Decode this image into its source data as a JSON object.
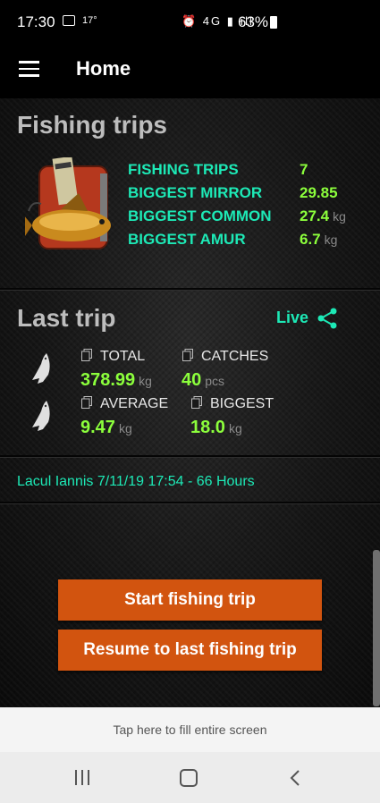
{
  "status_bar": {
    "time": "17:30",
    "temperature": "17°",
    "icons": "⏰ 4G ▮ ıll",
    "battery": "63%"
  },
  "app_bar": {
    "title": "Home",
    "menu_icon": "menu-icon"
  },
  "fishing_trips": {
    "heading": "Fishing trips",
    "stats": [
      {
        "label": "FISHING TRIPS",
        "value": "7",
        "unit": ""
      },
      {
        "label": "BIGGEST MIRROR",
        "value": "29.85",
        "unit": ""
      },
      {
        "label": "BIGGEST COMMON",
        "value": "27.4",
        "unit": "kg"
      },
      {
        "label": "BIGGEST AMUR",
        "value": "6.7",
        "unit": "kg"
      }
    ]
  },
  "last_trip": {
    "heading": "Last trip",
    "live_label": "Live",
    "total": {
      "label": "TOTAL",
      "value": "378.99",
      "unit": "kg"
    },
    "catches": {
      "label": "CATCHES",
      "value": "40",
      "unit": "pcs"
    },
    "average": {
      "label": "AVERAGE",
      "value": "9.47",
      "unit": "kg"
    },
    "biggest": {
      "label": "BIGGEST",
      "value": "18.0",
      "unit": "kg"
    },
    "info": "Lacul Iannis 7/11/19 17:54 - 66 Hours"
  },
  "buttons": {
    "start": "Start fishing trip",
    "resume": "Resume to last fishing trip"
  },
  "fill_screen": "Tap here to fill entire screen",
  "colors": {
    "accent_teal": "#1de9b6",
    "value_green": "#8cff3c",
    "button_orange": "#d2540f"
  }
}
